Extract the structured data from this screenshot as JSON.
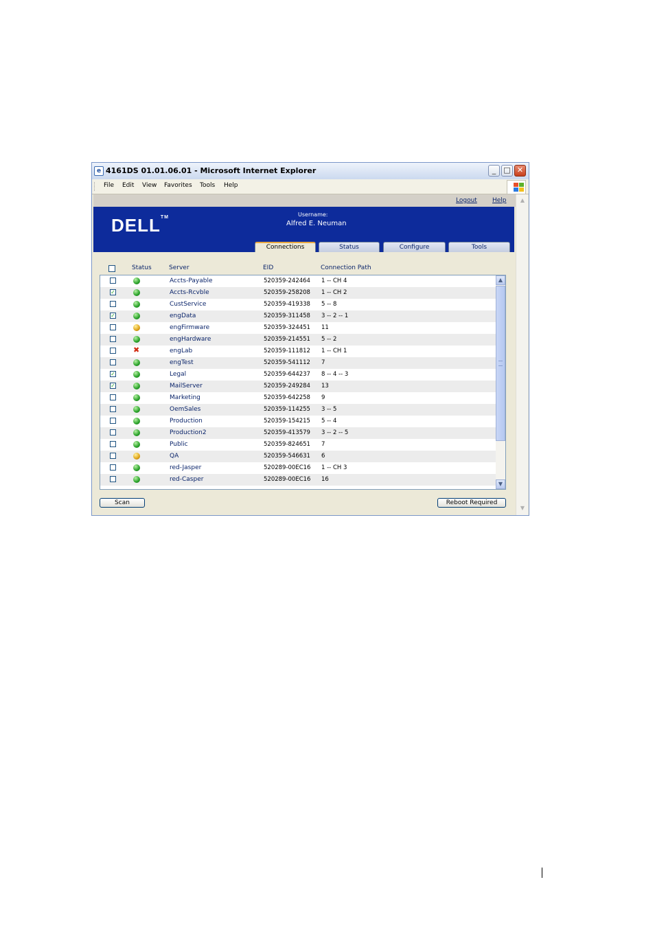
{
  "window": {
    "title": "4161DS 01.01.06.01 - Microsoft Internet Explorer",
    "app_icon_glyph": "e",
    "minimize_glyph": "_",
    "maximize_glyph": "□",
    "close_glyph": "✕"
  },
  "menu": [
    "File",
    "Edit",
    "View",
    "Favorites",
    "Tools",
    "Help"
  ],
  "toplinks": {
    "logout": "Logout",
    "help": "Help"
  },
  "banner": {
    "logo": "DELL",
    "logo_tm": "TM",
    "username_label": "Username:",
    "username": "Alfred E. Neuman"
  },
  "tabs": [
    {
      "label": "Connections",
      "active": true
    },
    {
      "label": "Status",
      "active": false
    },
    {
      "label": "Configure",
      "active": false
    },
    {
      "label": "Tools",
      "active": false
    }
  ],
  "columns": {
    "status": "Status",
    "server": "Server",
    "eid": "EID",
    "path": "Connection Path"
  },
  "rows": [
    {
      "checked": false,
      "status": "green",
      "server": "Accts-Payable",
      "eid": "520359-242464",
      "path": "1 -- CH 4"
    },
    {
      "checked": true,
      "status": "green",
      "server": "Accts-Rcvble",
      "eid": "520359-258208",
      "path": "1 -- CH 2"
    },
    {
      "checked": false,
      "status": "green",
      "server": "CustService",
      "eid": "520359-419338",
      "path": "5 -- 8"
    },
    {
      "checked": true,
      "status": "green",
      "server": "engData",
      "eid": "520359-311458",
      "path": "3 -- 2 -- 1"
    },
    {
      "checked": false,
      "status": "yellow",
      "server": "engFirmware",
      "eid": "520359-324451",
      "path": "11"
    },
    {
      "checked": false,
      "status": "green",
      "server": "engHardware",
      "eid": "520359-214551",
      "path": "5 -- 2"
    },
    {
      "checked": false,
      "status": "red",
      "server": "engLab",
      "eid": "520359-111812",
      "path": "1 -- CH 1"
    },
    {
      "checked": false,
      "status": "green",
      "server": "engTest",
      "eid": "520359-541112",
      "path": "7"
    },
    {
      "checked": true,
      "status": "green",
      "server": "Legal",
      "eid": "520359-644237",
      "path": "8 -- 4 -- 3"
    },
    {
      "checked": true,
      "status": "green",
      "server": "MailServer",
      "eid": "520359-249284",
      "path": "13"
    },
    {
      "checked": false,
      "status": "green",
      "server": "Marketing",
      "eid": "520359-642258",
      "path": "9"
    },
    {
      "checked": false,
      "status": "green",
      "server": "OemSales",
      "eid": "520359-114255",
      "path": "3 -- 5"
    },
    {
      "checked": false,
      "status": "green",
      "server": "Production",
      "eid": "520359-154215",
      "path": "5 -- 4"
    },
    {
      "checked": false,
      "status": "green",
      "server": "Production2",
      "eid": "520359-413579",
      "path": "3 -- 2 -- 5"
    },
    {
      "checked": false,
      "status": "green",
      "server": "Public",
      "eid": "520359-824651",
      "path": "7"
    },
    {
      "checked": false,
      "status": "yellow",
      "server": "QA",
      "eid": "520359-546631",
      "path": "6"
    },
    {
      "checked": false,
      "status": "green",
      "server": "red-Jasper",
      "eid": "520289-00EC16",
      "path": "1 -- CH 3"
    },
    {
      "checked": false,
      "status": "green",
      "server": "red-Casper",
      "eid": "520289-00EC16",
      "path": "16"
    }
  ],
  "buttons": {
    "scan": "Scan",
    "reboot": "Reboot Required"
  },
  "glyphs": {
    "check": "✓",
    "up": "▲",
    "down": "▼",
    "red_x": "✖"
  },
  "colors": {
    "banner": "#0d2b9b",
    "ok": "#2aa22a",
    "warn": "#e0a418",
    "error": "#d12a10"
  }
}
